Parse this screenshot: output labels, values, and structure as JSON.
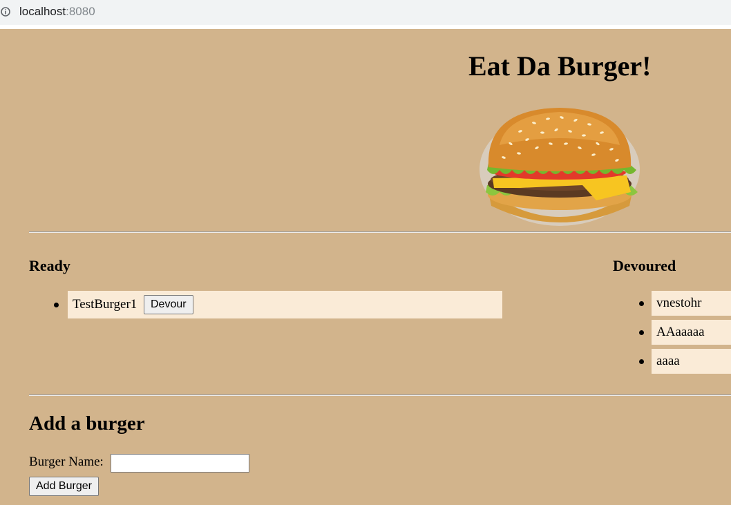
{
  "browser": {
    "url_host": "localhost",
    "url_port": ":8080"
  },
  "header": {
    "title": "Eat Da Burger!",
    "image_icon": "burger-image"
  },
  "ready": {
    "heading": "Ready",
    "items": [
      {
        "name": "TestBurger1",
        "button_label": "Devour"
      }
    ]
  },
  "devoured": {
    "heading": "Devoured",
    "items": [
      {
        "name": "vnestohr"
      },
      {
        "name": "AAaaaaa"
      },
      {
        "name": "aaaa"
      }
    ]
  },
  "add_form": {
    "heading": "Add a burger",
    "label": "Burger Name:",
    "input_value": "",
    "input_placeholder": "",
    "submit_label": "Add Burger"
  },
  "colors": {
    "page_background": "#d2b48c",
    "item_background": "#faebd7"
  }
}
